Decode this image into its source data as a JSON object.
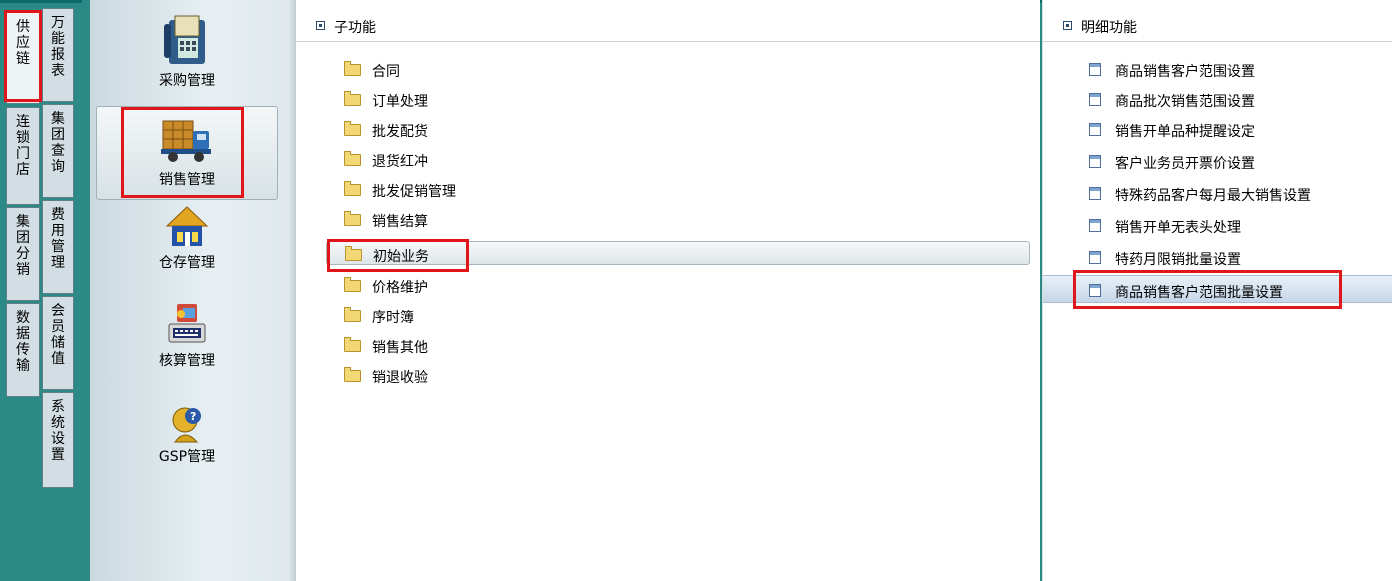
{
  "side_tabs": [
    {
      "label": "供应链"
    },
    {
      "label": "万能报表"
    },
    {
      "label": "连锁门店"
    },
    {
      "label": "集团查询"
    },
    {
      "label": "集团分销"
    },
    {
      "label": "费用管理"
    },
    {
      "label": "数据传输"
    },
    {
      "label": "会员储值"
    },
    {
      "label": "系统设置"
    }
  ],
  "categories": [
    {
      "label": "采购管理",
      "icon": "fax-phone-icon"
    },
    {
      "label": "销售管理",
      "icon": "delivery-truck-icon"
    },
    {
      "label": "仓存管理",
      "icon": "warehouse-icon"
    },
    {
      "label": "核算管理",
      "icon": "calculator-keyboard-icon"
    },
    {
      "label": "GSP管理",
      "icon": "user-help-icon"
    }
  ],
  "sub_panel": {
    "title": "子功能",
    "items": [
      "合同",
      "订单处理",
      "批发配货",
      "退货红冲",
      "批发促销管理",
      "销售结算",
      "初始业务",
      "价格维护",
      "序时簿",
      "销售其他",
      "销退收验"
    ],
    "selected": "初始业务"
  },
  "detail_panel": {
    "title": "明细功能",
    "items": [
      "商品销售客户范围设置",
      "商品批次销售范围设置",
      "销售开单品种提醒设定",
      "客户业务员开票价设置",
      "特殊药品客户每月最大销售设置",
      "销售开单无表头处理",
      "特药月限销批量设置",
      "商品销售客户范围批量设置"
    ],
    "selected": "商品销售客户范围批量设置"
  },
  "colors": {
    "background": "#2c8a86",
    "highlight_box": "#e0161b"
  }
}
